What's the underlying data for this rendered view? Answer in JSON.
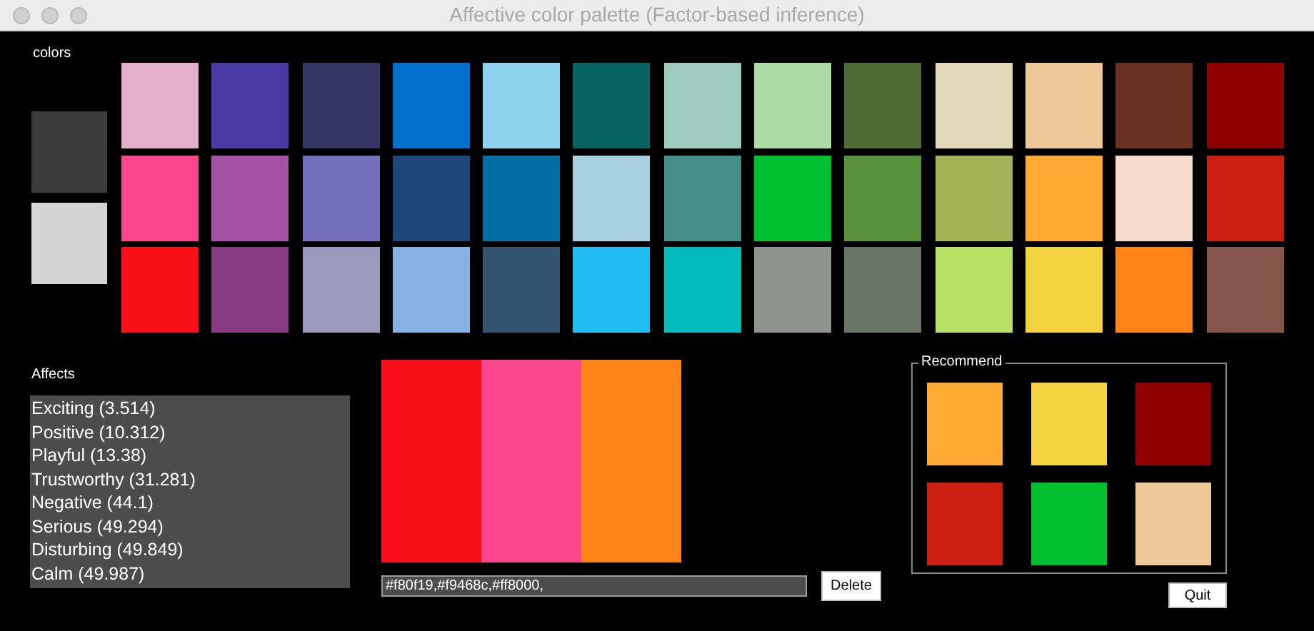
{
  "window": {
    "title": "Affective color palette (Factor-based inference)"
  },
  "colors_label": "colors",
  "current": [
    {
      "color": "#3c3c3c"
    },
    {
      "color": "#d4d4d4"
    }
  ],
  "swatches": [
    [
      {
        "color": "#e3afc9"
      },
      {
        "color": "#4a3aa5"
      },
      {
        "color": "#343766"
      },
      {
        "color": "#0070cc"
      },
      {
        "color": "#8dd3f0"
      },
      {
        "color": "#076360"
      },
      {
        "color": "#9fcbc1"
      },
      {
        "color": "#acdba6"
      },
      {
        "color": "#516b35"
      },
      {
        "color": "#e0d8b9"
      },
      {
        "color": "#eec898"
      },
      {
        "color": "#6a3220"
      },
      {
        "color": "#900000"
      }
    ],
    [
      {
        "color": "#f9468c"
      },
      {
        "color": "#a452a6"
      },
      {
        "color": "#7570bb"
      },
      {
        "color": "#1c487a"
      },
      {
        "color": "#016ea4"
      },
      {
        "color": "#a8d1df"
      },
      {
        "color": "#468e88"
      },
      {
        "color": "#00bf31"
      },
      {
        "color": "#58913c"
      },
      {
        "color": "#a2b355"
      },
      {
        "color": "#ffab33"
      },
      {
        "color": "#f5dccb"
      },
      {
        "color": "#cc1f14"
      }
    ],
    [
      {
        "color": "#f80f19"
      },
      {
        "color": "#873b82"
      },
      {
        "color": "#9a9abd"
      },
      {
        "color": "#85b2e3"
      },
      {
        "color": "#32546f"
      },
      {
        "color": "#22bdf0"
      },
      {
        "color": "#02bbbb"
      },
      {
        "color": "#8d948e"
      },
      {
        "color": "#6b7565"
      },
      {
        "color": "#b8e265"
      },
      {
        "color": "#f4d340"
      },
      {
        "color": "#ff8317"
      },
      {
        "color": "#87554a"
      }
    ]
  ],
  "affects_label": "Affects",
  "affects": [
    "Exciting (3.514)",
    "Positive (10.312)",
    "Playful (13.38)",
    "Trustworthy (31.281)",
    "Negative (44.1)",
    "Serious (49.294)",
    "Disturbing (49.849)",
    "Calm (49.987)"
  ],
  "palette": [
    {
      "color": "#f80f19"
    },
    {
      "color": "#f9468c"
    },
    {
      "color": "#ff8317"
    }
  ],
  "palette_field": {
    "value": "#f80f19,#f9468c,#ff8000,"
  },
  "delete_button": "Delete",
  "recommend": {
    "title": "Recommend",
    "colors": [
      {
        "color": "#ffab33"
      },
      {
        "color": "#f4d340"
      },
      {
        "color": "#900000"
      },
      {
        "color": "#cc1f14"
      },
      {
        "color": "#00bf31"
      },
      {
        "color": "#eec898"
      }
    ]
  },
  "quit_button": "Quit"
}
